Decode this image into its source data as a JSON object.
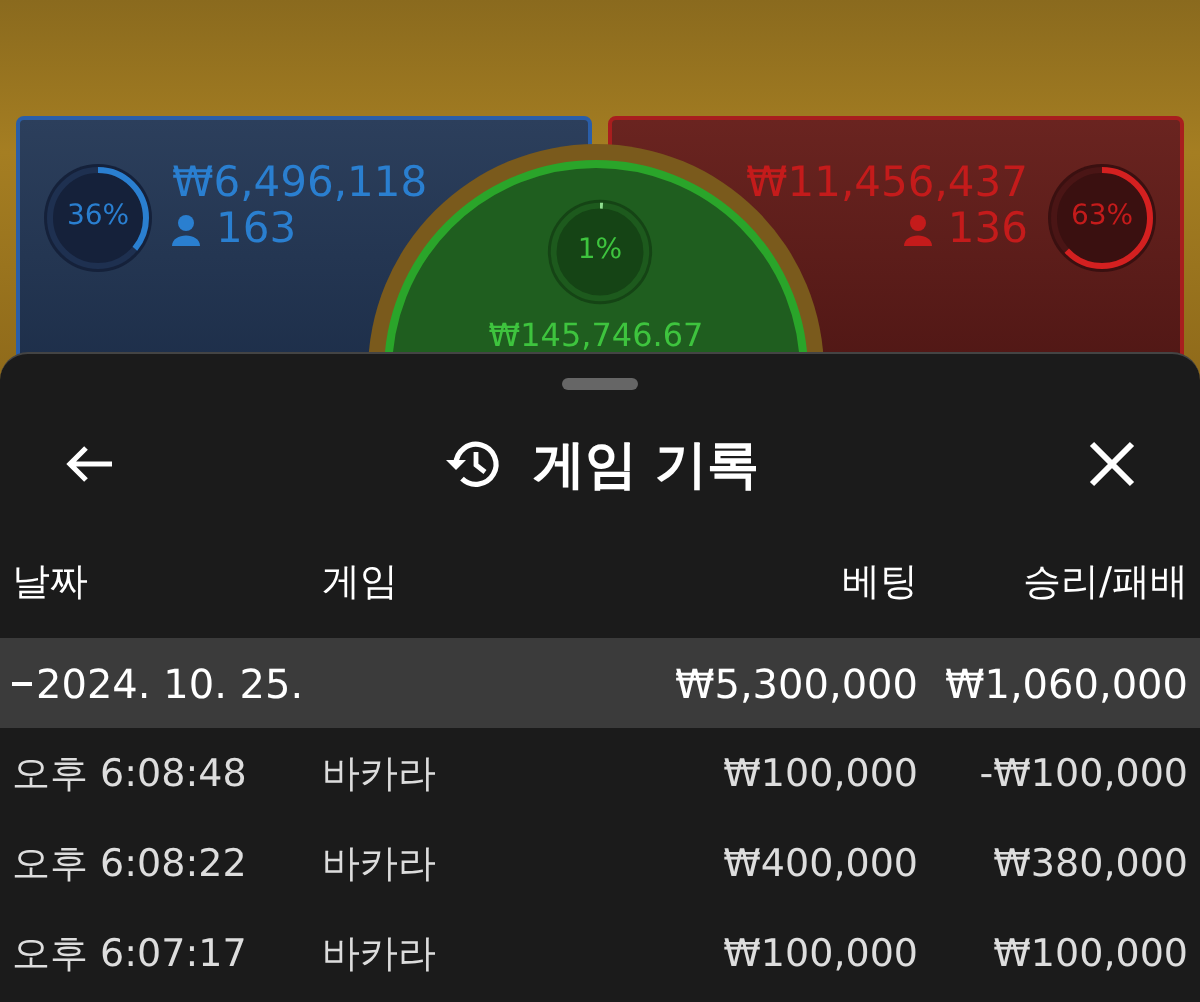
{
  "bets": {
    "player": {
      "share": "36%",
      "level": 0.36,
      "amount": "₩6,496,118",
      "count": "163"
    },
    "tie": {
      "share": "1%",
      "level": 0.01,
      "amount": "₩145,746.67"
    },
    "banker": {
      "share": "63%",
      "level": 0.63,
      "amount": "₩11,456,437",
      "count": "136"
    }
  },
  "sheet": {
    "title": "게임 기록",
    "columns": [
      "날짜",
      "게임",
      "베팅",
      "승리/패배"
    ],
    "groups": [
      {
        "label": "2024. 10. 25.",
        "expanded": true,
        "bet_total": "₩5,300,000",
        "result_total": "₩1,060,000",
        "rows": [
          {
            "time": "오후 6:08:48",
            "game": "바카라",
            "bet": "₩100,000",
            "result": "-₩100,000"
          },
          {
            "time": "오후 6:08:22",
            "game": "바카라",
            "bet": "₩400,000",
            "result": "₩380,000"
          },
          {
            "time": "오후 6:07:17",
            "game": "바카라",
            "bet": "₩100,000",
            "result": "₩100,000"
          }
        ]
      }
    ]
  }
}
